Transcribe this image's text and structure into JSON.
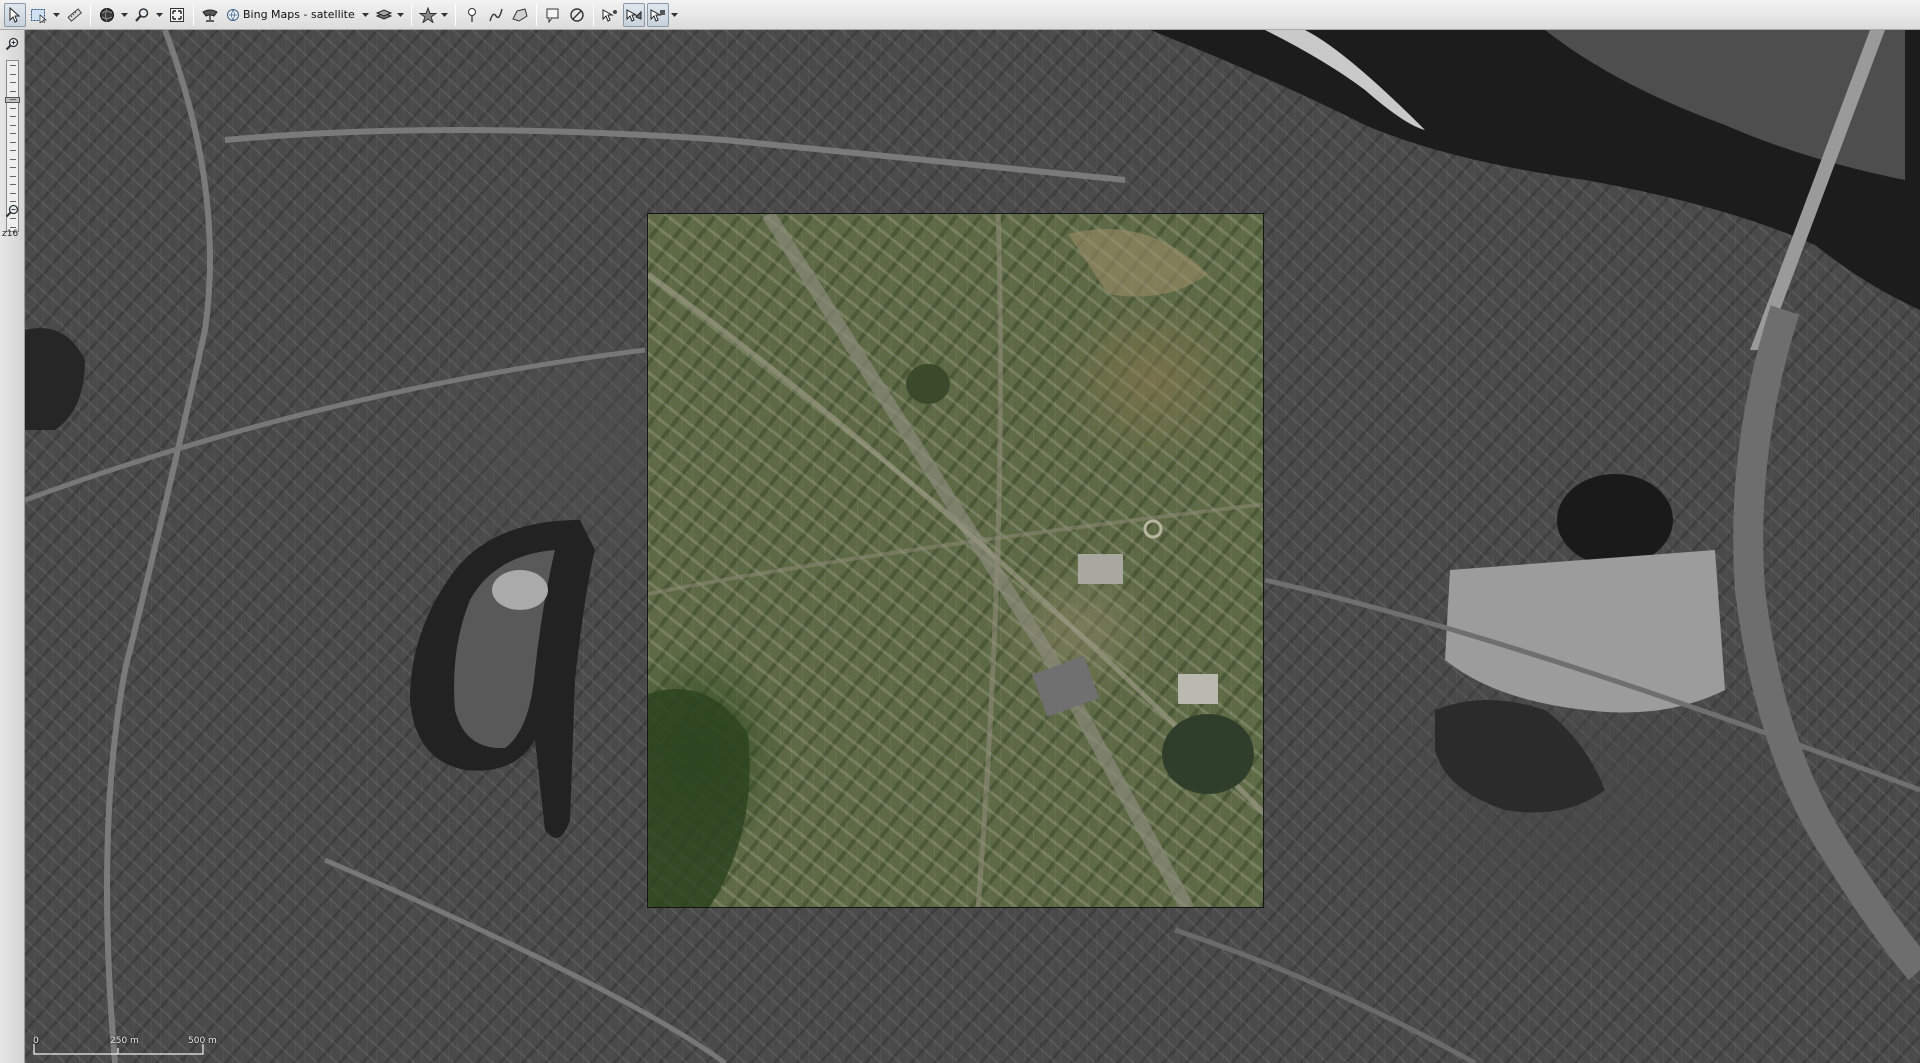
{
  "toolbar": {
    "buttons": [
      {
        "name": "select-tool",
        "icon": "cursor-arrow-icon",
        "active": true
      },
      {
        "name": "selection-options",
        "icon": "selection-box-icon",
        "dropdown": true
      },
      {
        "name": "measure-tool",
        "icon": "ruler-icon"
      },
      {
        "name": "globe-tool",
        "icon": "globe-icon",
        "dropdown": true
      },
      {
        "name": "search-tool",
        "icon": "magnifier-icon",
        "dropdown": true
      },
      {
        "name": "full-extent",
        "icon": "fullscreen-icon"
      },
      {
        "name": "map-source-icon",
        "icon": "satellite-dish-icon"
      },
      {
        "name": "layers-tool",
        "icon": "layers-icon",
        "dropdown": true
      },
      {
        "name": "favorites-tool",
        "icon": "star-icon",
        "dropdown": true
      },
      {
        "name": "placemark-tool",
        "icon": "pin-icon"
      },
      {
        "name": "path-tool",
        "icon": "path-icon"
      },
      {
        "name": "polygon-tool",
        "icon": "polygon-icon"
      },
      {
        "name": "annotation-tool",
        "icon": "note-icon"
      },
      {
        "name": "no-entry-tool",
        "icon": "prohibit-icon"
      },
      {
        "name": "edit-points-tool",
        "icon": "edit-points-icon",
        "active": true
      },
      {
        "name": "edit-shapes-tool",
        "icon": "edit-shapes-icon",
        "active": true
      }
    ],
    "map_source_label": "Bing Maps - satellite"
  },
  "zoom_panel": {
    "zoom_label": "z16",
    "zoom_level": 16,
    "ticks": 20
  },
  "map": {
    "scale_labels": [
      "0",
      "250 m",
      "500 m"
    ],
    "colors": {
      "water": "#1c1c1c",
      "aoi_border": "#151515",
      "toolbar_bg": "#e6e6e6"
    }
  }
}
